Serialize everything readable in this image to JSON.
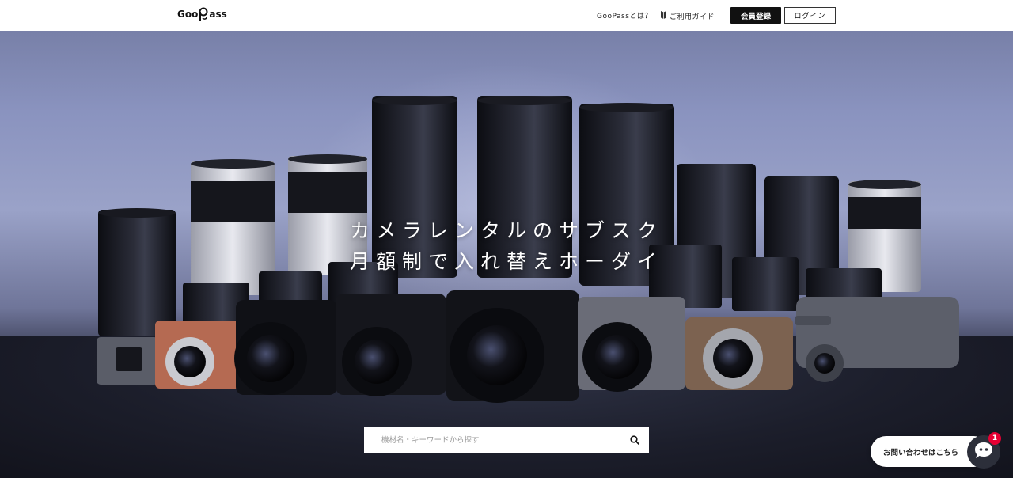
{
  "header": {
    "logo_text_left": "Goo",
    "logo_text_right": "ass",
    "nav": {
      "about": "GooPassとは？",
      "guide": "ご利用ガイド"
    },
    "register_label": "会員登録",
    "login_label": "ログイン"
  },
  "hero": {
    "title_line1": "カメラレンタルのサブスク",
    "title_line2": "月額制で入れ替えホーダイ",
    "search": {
      "placeholder": "機材名・キーワードから探す",
      "value": ""
    }
  },
  "chat": {
    "label": "お問い合わせはこちら",
    "badge_count": "1"
  },
  "colors": {
    "header_bg": "#ffffff",
    "register_bg": "#111111",
    "badge": "#e60033",
    "chat_bubble": "#2c2f3a"
  },
  "icons": {
    "search": "search-icon",
    "guide": "guide-book-icon",
    "chat": "chat-face-icon"
  }
}
